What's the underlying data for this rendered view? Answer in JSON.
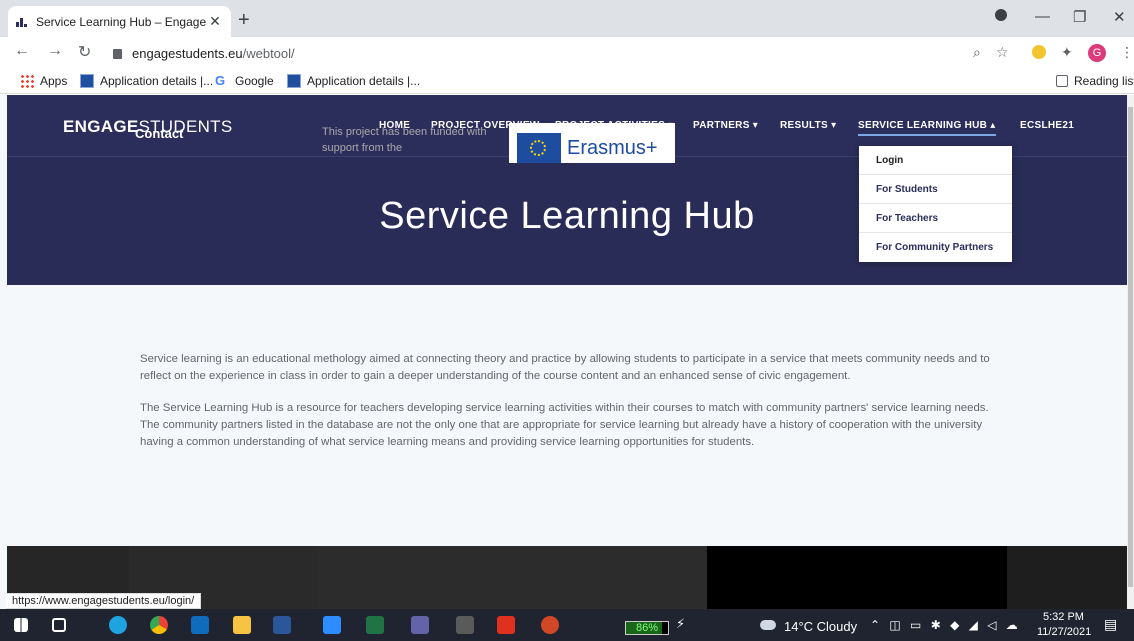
{
  "browser": {
    "tab_title": "Service Learning Hub – EngageSt",
    "tab_close": "✕",
    "new_tab": "+",
    "url_host": "engagestudents.eu",
    "url_path": "/webtool/",
    "avatar_letter": "G",
    "reading_list": "Reading list",
    "bookmarks": [
      "Apps",
      "Application details |...",
      "Google",
      "Application details |..."
    ]
  },
  "site": {
    "brand_bold": "ENGAGE",
    "brand_rest": "STUDENTS",
    "nav": [
      "HOME",
      "PROJECT OVERVIEW",
      "PROJECT ACTIVITIES ▾",
      "PARTNERS ▾",
      "RESULTS ▾",
      "SERVICE LEARNING HUB ▴",
      "ECSLHE21"
    ],
    "hero_title": "Service Learning Hub",
    "dropdown": [
      "Login",
      "For Students",
      "For Teachers",
      "For Community Partners"
    ],
    "para1": "Service learning is an educational methology aimed at connecting theory and practice by allowing students to participate in a service that meets community needs and to reflect on the experience in class in order to gain a deeper understanding of the course content and an enhanced sense of civic engagement.",
    "para2": "The Service Learning Hub is a resource for teachers developing service learning activities within their courses to match with community partners' service learning needs.  The community partners listed in the database are not the only one that are appropriate for service learning but already have a history of cooperation with the university having a common understanding of what service learning means and providing service learning opportunities for students.",
    "footer_contact": "Contact",
    "footer_funded": "This project has been funded with support from the",
    "erasmus": "Erasmus+"
  },
  "status_url": "https://www.engagestudents.eu/login/",
  "taskbar": {
    "battery": "86%",
    "battery_level": 0.86,
    "weather": "14°C  Cloudy",
    "time": "5:32 PM",
    "date": "11/27/2021"
  }
}
